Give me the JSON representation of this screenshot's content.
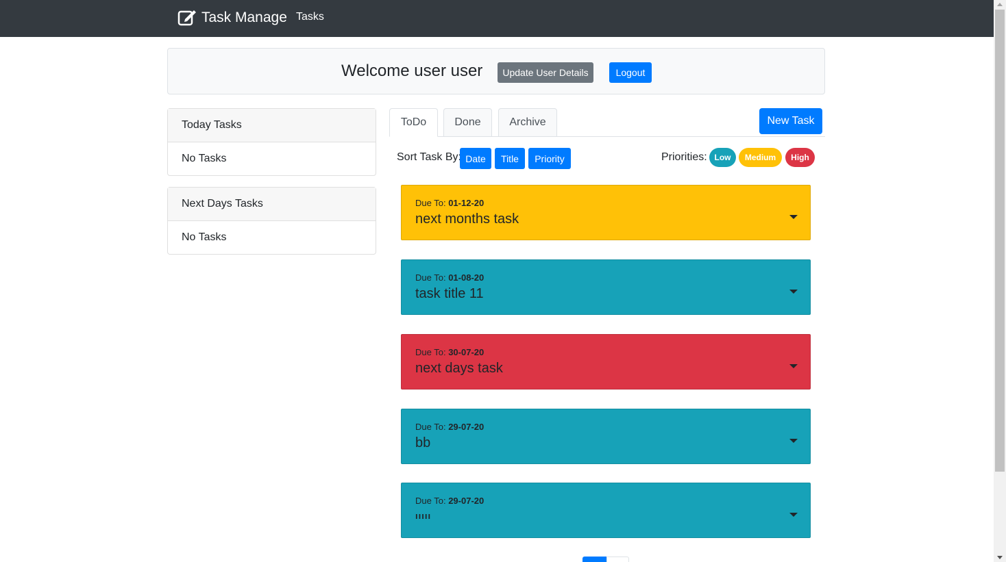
{
  "navbar": {
    "brand": "Task Manage",
    "brand_icon": "edit-icon",
    "links": [
      "Tasks"
    ]
  },
  "welcome": {
    "title": "Welcome user user",
    "update_button": "Update User Details",
    "logout_button": "Logout"
  },
  "sidebar": {
    "today": {
      "header": "Today Tasks",
      "body": "No Tasks"
    },
    "next": {
      "header": "Next Days Tasks",
      "body": "No Tasks"
    }
  },
  "tabs": {
    "items": [
      "ToDo",
      "Done",
      "Archive"
    ],
    "active": "ToDo",
    "new_task_button": "New Task"
  },
  "sort": {
    "label": "Sort Task By:",
    "options": [
      "Date",
      "Title",
      "Priority"
    ]
  },
  "priorities": {
    "label": "Priorities:",
    "items": [
      {
        "label": "Low",
        "color": "#17a2b8"
      },
      {
        "label": "Medium",
        "color": "#ffc107"
      },
      {
        "label": "High",
        "color": "#dc3545"
      }
    ]
  },
  "tasks": [
    {
      "due_label": "Due To:",
      "due": "01-12-20",
      "title": "next months task",
      "priority": "Medium",
      "color": "#ffc107"
    },
    {
      "due_label": "Due To:",
      "due": "01-08-20",
      "title": "task title 11",
      "priority": "Low",
      "color": "#17a2b8"
    },
    {
      "due_label": "Due To:",
      "due": "30-07-20",
      "title": "next days task",
      "priority": "High",
      "color": "#dc3545"
    },
    {
      "due_label": "Due To:",
      "due": "29-07-20",
      "title": "bb",
      "priority": "Low",
      "color": "#17a2b8"
    },
    {
      "due_label": "Due To:",
      "due": "29-07-20",
      "title": "ııııı",
      "priority": "Low",
      "color": "#17a2b8"
    }
  ],
  "colors": {
    "primary": "#007bff",
    "secondary": "#6c757d",
    "navbar": "#343a40"
  }
}
